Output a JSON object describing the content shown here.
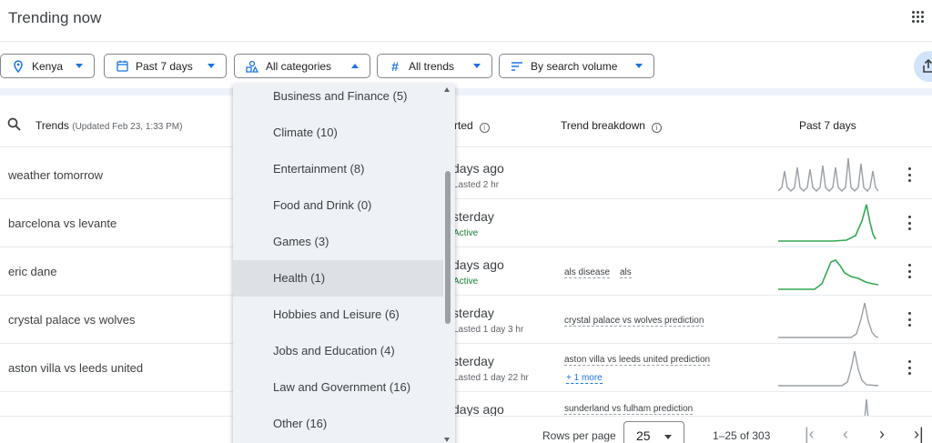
{
  "header": {
    "title": "Trending now"
  },
  "filters": {
    "location": "Kenya",
    "time": "Past 7 days",
    "category": "All categories",
    "trends": "All trends",
    "sort": "By search volume"
  },
  "table": {
    "col_trends": "Trends",
    "col_updated": "(Updated Feb 23, 1:33 PM)",
    "col_started": "rted",
    "col_breakdown": "Trend breakdown",
    "col_past": "Past 7 days",
    "rows": [
      {
        "name": "weather tomorrow",
        "started": "days ago",
        "sub": "Lasted 2 hr",
        "breakdown": [],
        "more": ""
      },
      {
        "name": "barcelona vs levante",
        "started": "sterday",
        "sub": "Active",
        "breakdown": [],
        "more": ""
      },
      {
        "name": "eric dane",
        "started": "days ago",
        "sub": "Active",
        "breakdown": [
          "als disease",
          "als"
        ],
        "more": ""
      },
      {
        "name": "crystal palace vs wolves",
        "started": "sterday",
        "sub": "Lasted 1 day 3 hr",
        "breakdown": [
          "crystal palace vs wolves prediction"
        ],
        "more": ""
      },
      {
        "name": "aston villa vs leeds united",
        "started": "sterday",
        "sub": "Lasted 1 day 22 hr",
        "breakdown": [
          "aston villa vs leeds united prediction"
        ],
        "more": "+ 1 more"
      },
      {
        "name": "",
        "started": "days ago",
        "sub": "",
        "breakdown": [
          "sunderland vs fulham prediction"
        ],
        "more": ""
      }
    ]
  },
  "menu": {
    "items": [
      "Business and Finance (5)",
      "Climate (10)",
      "Entertainment (8)",
      "Food and Drink (0)",
      "Games (3)",
      "Health (1)",
      "Hobbies and Leisure (6)",
      "Jobs and Education (4)",
      "Law and Government (16)",
      "Other (16)"
    ],
    "highlighted": "Health (1)"
  },
  "footer": {
    "rows_label": "Rows per page",
    "rows_value": "25",
    "count": "1–25 of 303"
  },
  "colors": {
    "accent": "#1a73e8",
    "active": "#34a853",
    "inactive_spark": "#9aa0a6"
  }
}
